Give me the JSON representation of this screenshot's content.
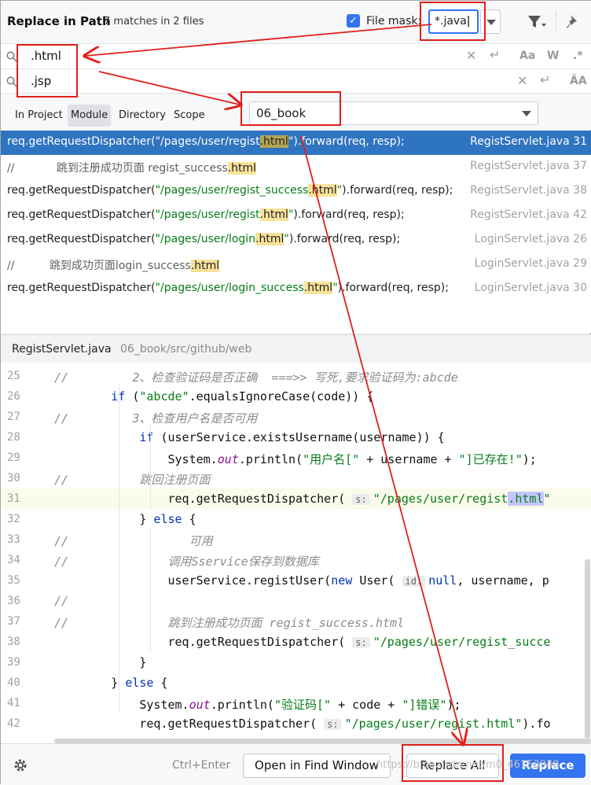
{
  "header": {
    "title": "Replace in Path",
    "subtitle": "7 matches in 2 files",
    "file_mask_label": "File mask:",
    "file_mask_value": "*.java"
  },
  "search": {
    "find_value": ".html",
    "replace_value": ".jsp",
    "options": {
      "match_case": "Aa",
      "words": "W",
      "regex": ".*",
      "preserve_case": "ÂA"
    }
  },
  "scope": {
    "tabs": [
      "In Project",
      "Module",
      "Directory",
      "Scope"
    ],
    "active": "Module",
    "selected_module": "06_book"
  },
  "results": [
    {
      "prefix": "req.getRequestDispatcher(",
      "str1": "\"/pages/user/regist",
      "hl": ".html",
      "str2": "\"",
      "suffix": ").forward(req, resp);",
      "file": "RegistServlet.java 31",
      "selected": true
    },
    {
      "prefix": "//            ",
      "comment": "跳到注册成功页面 regist_success",
      "hl": ".html",
      "file": "RegistServlet.java 37"
    },
    {
      "prefix": "req.getRequestDispatcher(",
      "str1": "\"/pages/user/regist_success",
      "hl": ".html",
      "str2": "\"",
      "suffix": ").forward(req, resp);",
      "file": "RegistServlet.java 38"
    },
    {
      "prefix": "req.getRequestDispatcher(",
      "str1": "\"/pages/user/regist",
      "hl": ".html",
      "str2": "\"",
      "suffix": ").forward(req, resp);",
      "file": "RegistServlet.java 42"
    },
    {
      "prefix": "req.getRequestDispatcher(",
      "str1": "\"/pages/user/login",
      "hl": ".html",
      "str2": "\"",
      "suffix": ").forward(req, resp);",
      "file": "LoginServlet.java 26"
    },
    {
      "prefix": "//          ",
      "comment": "跳到成功页面login_success",
      "hl": ".html",
      "file": "LoginServlet.java 29"
    },
    {
      "prefix": "req.getRequestDispatcher(",
      "str1": "\"/pages/user/login_success",
      "hl": ".html",
      "str2": "\"",
      "suffix": ").forward(req, resp);",
      "file": "LoginServlet.java 30"
    }
  ],
  "editor": {
    "file": "RegistServlet.java",
    "path": "06_book/src/github/web",
    "lines": [
      {
        "n": "25",
        "html": "<span class='cc'>//         2、检查验证码是否正确  ===>> 写死,要求验证码为:abcde</span>"
      },
      {
        "n": "26",
        "html": "        <span class='kw'>if</span> (<span class='cs'>\"abcde\"</span>.equalsIgnoreCase(code)) {"
      },
      {
        "n": "27",
        "html": "<span class='cc'>//         3、检查用户名是否可用</span>"
      },
      {
        "n": "28",
        "html": "            <span class='kw'>if</span> (userService.existsUsername(username)) {"
      },
      {
        "n": "29",
        "html": "                System.<span class='fld'>out</span>.println(<span class='cs'>\"用户名[\"</span> + username + <span class='cs'>\"]已存在!\"</span>);"
      },
      {
        "n": "30",
        "html": "<span class='cc'>//          跳回注册页面</span>"
      },
      {
        "n": "31",
        "html": "                req.getRequestDispatcher( <span class='hint'>s:</span><span class='cs'>\"/pages/user/regist<span class='mhl'>.html</span>\"</span>",
        "curr": true
      },
      {
        "n": "32",
        "html": "            } <span class='kw'>else</span> {"
      },
      {
        "n": "33",
        "html": "<span class='cc'>//                 可用</span>"
      },
      {
        "n": "34",
        "html": "<span class='cc'>//              调用Sservice保存到数据库</span>"
      },
      {
        "n": "35",
        "html": "                userService.registUser(<span class='kw'>new</span> User( <span class='hint'>id:</span><span class='kw'>null</span>, username, p"
      },
      {
        "n": "36",
        "html": "<span class='cc'>//</span>"
      },
      {
        "n": "37",
        "html": "<span class='cc'>//              跳到注册成功页面 regist_success.html</span>"
      },
      {
        "n": "38",
        "html": "                req.getRequestDispatcher( <span class='hint'>s:</span><span class='cs'>\"/pages/user/regist_succe</span>"
      },
      {
        "n": "39",
        "html": "            }"
      },
      {
        "n": "40",
        "html": "        } <span class='kw'>else</span> {"
      },
      {
        "n": "41",
        "html": "            System.<span class='fld'>out</span>.println(<span class='cs'>\"验证码[\"</span> + code + <span class='cs'>\"]错误\"</span>);"
      },
      {
        "n": "42",
        "html": "            req.getRequestDispatcher( <span class='hint'>s:</span><span class='cs'>\"/pages/user/regist.html\"</span>).fo"
      }
    ]
  },
  "footer": {
    "shortcut": "Ctrl+Enter",
    "open_find_window": "Open in Find Window",
    "replace_all": "Replace All",
    "replace": "Replace",
    "watermark": "https://blog.csdn.net/m0_46153949"
  },
  "colors": {
    "accent": "#3574f0",
    "selection": "#2f74c0",
    "annotation": "#e0201c",
    "match_highlight": "#f7e29a"
  }
}
